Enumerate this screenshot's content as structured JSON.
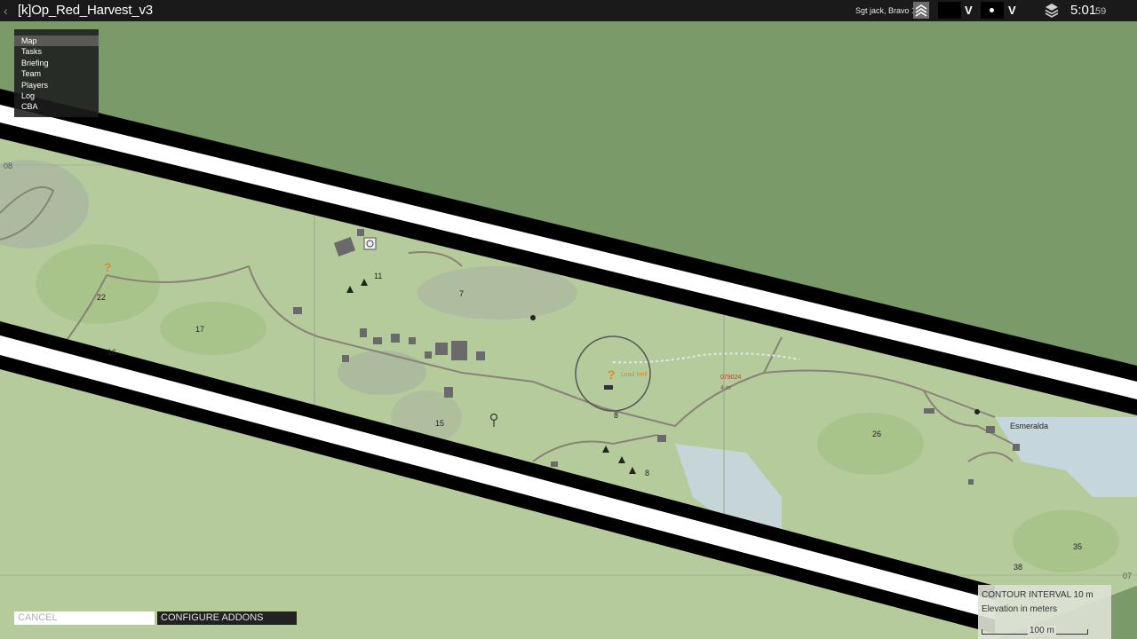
{
  "topbar": {
    "title": "[k]Op_Red_Harvest_v3",
    "player": "Sgt jack, Bravo 1",
    "time_main": "5:01",
    "time_seconds": "59",
    "icons": [
      "back-icon",
      "rank-icon",
      "chevron-down-icon",
      "dot-icon",
      "layers-icon"
    ]
  },
  "menu": {
    "items": [
      {
        "label": "Map",
        "active": true
      },
      {
        "label": "Tasks",
        "active": false
      },
      {
        "label": "Briefing",
        "active": false
      },
      {
        "label": "Team",
        "active": false
      },
      {
        "label": "Players",
        "active": false
      },
      {
        "label": "Log",
        "active": false
      },
      {
        "label": "CBA",
        "active": false
      }
    ]
  },
  "map": {
    "grid_labels": [
      "08",
      "07"
    ],
    "heights": [
      "22",
      "17",
      "16",
      "11",
      "7",
      "15",
      "8",
      "8",
      "26",
      "35",
      "38"
    ],
    "town": "Esmeralda",
    "marker_label": "Lead Hell",
    "red_marker_line1": "079024",
    "red_marker_line2": "4 m",
    "colors": {
      "ocean": "#7b9a6a",
      "land": "#b9cfa0",
      "forest": "#a9c48f",
      "water": "#c6d6df",
      "road": "#8a8276",
      "marker_orange": "#e08a2c",
      "marker_red": "#c43a2a"
    }
  },
  "buttons": {
    "cancel": "CANCEL",
    "configure": "CONFIGURE ADDONS"
  },
  "legend": {
    "contour": "CONTOUR INTERVAL 10 m",
    "elevation": "Elevation in meters",
    "scale": "100 m"
  }
}
